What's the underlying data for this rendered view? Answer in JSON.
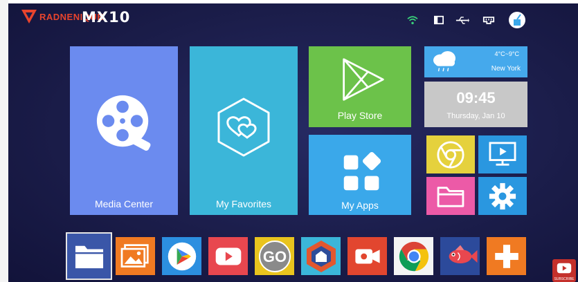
{
  "topbar": {
    "watermark": "RADNENIQUE",
    "model": "MX10"
  },
  "tiles": {
    "media_center": "Media Center",
    "my_favorites": "My Favorites",
    "play_store": "Play Store",
    "my_apps": "My Apps"
  },
  "weather": {
    "temp_range": "4°C~9°C",
    "city": "New York"
  },
  "clock": {
    "time": "09:45",
    "date": "Thursday, Jan 10"
  },
  "dock": [
    "file-manager",
    "gallery",
    "google-play",
    "youtube",
    "go-app",
    "app-launcher",
    "screen-recorder",
    "chrome",
    "fish-app",
    "add"
  ],
  "subscribe": "SUBSCRIBE",
  "colors": {
    "background": "#1b1d4a",
    "media": "#6b8bef",
    "favorites": "#3bb6d9",
    "play_store": "#6cc24a",
    "my_apps": "#3aa8ea",
    "wifi": "#3ad17a"
  }
}
